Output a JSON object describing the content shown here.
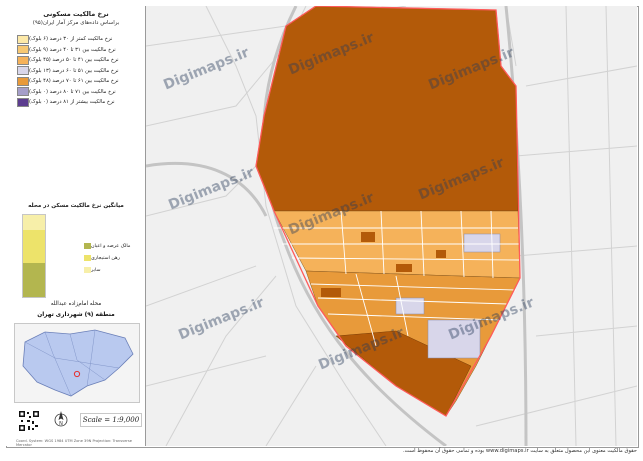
{
  "legend": {
    "title": "نرخ مالکیت مسکونی",
    "subtitle": "براساس داده‌های مرکز آمار ایران(۹۵)",
    "items": [
      {
        "label": "نرخ مالکیت کمتر از ۳۰ درصد (۶ بلوک)",
        "color": "#fde9a8"
      },
      {
        "label": "نرخ مالکیت بین ۳۱ تا ۴۰ درصد (۹ بلوک)",
        "color": "#f7c873"
      },
      {
        "label": "نرخ مالکیت بین ۴۱ تا ۵۰ درصد (۴۵ بلوک)",
        "color": "#f5b25a"
      },
      {
        "label": "نرخ مالکیت بین ۵۱ تا ۶۰ درصد (۱۳ بلوک)",
        "color": "#d8d6ea"
      },
      {
        "label": "نرخ مالکیت بین ۶۱ تا ۷۰ درصد (۴۸ بلوک)",
        "color": "#e89a3a"
      },
      {
        "label": "نرخ مالکیت بین ۷۱ تا ۸۰ درصد (۰ بلوک)",
        "color": "#a59ec9"
      },
      {
        "label": "نرخ مالکیت بیشتر از ۸۱ درصد (۰ بلوک)",
        "color": "#5c3d8f"
      }
    ]
  },
  "stack": {
    "title": "میانگین نرخ مالکیت مسکن در محله",
    "segments": [
      {
        "label": "مالک عرصه و اعیان",
        "color": "#b3b64f",
        "share": 0.42
      },
      {
        "label": "رهن استیجاری",
        "color": "#ede36a",
        "share": 0.4
      },
      {
        "label": "سایر",
        "color": "#f7efa9",
        "share": 0.18
      }
    ]
  },
  "location": {
    "title": "محله امام‌زاده عبدالله",
    "subtitle": "منطقه (۹) شهرداری تهران"
  },
  "scale": "Scale = 1:9,000",
  "credit": "Coord. System: WGS 1984 UTM Zone 39N   Projection: Transverse Mercator",
  "watermarks": [
    "Digimaps.ir",
    "Digimaps.ir",
    "Digimaps.ir",
    "Digimaps.ir",
    "Digimaps.ir",
    "Digimaps.ir",
    "Digimaps.ir",
    "Digimaps.ir",
    "Digimaps.ir"
  ],
  "footer": "حقوق مالکیت معنوی این محصول متعلق به سایت www.digimaps.ir بوده و تمامی حقوق آن محفوظ است.",
  "colors": {
    "dominant_block": "#b35a09",
    "boundary": "#ff5a5a",
    "background_map": "#f2f2f2"
  }
}
